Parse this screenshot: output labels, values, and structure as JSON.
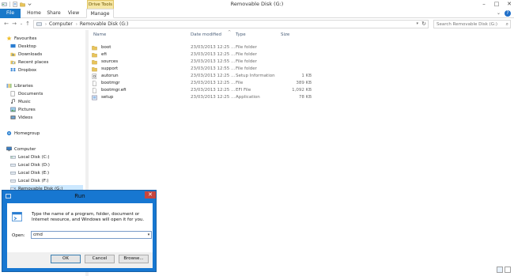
{
  "window": {
    "title": "Removable Disk (G:)",
    "contextual_tab": "Drive Tools",
    "controls": [
      "–",
      "□",
      "✕"
    ]
  },
  "ribbon": {
    "tabs": [
      {
        "label": "File",
        "active": true
      },
      {
        "label": "Home"
      },
      {
        "label": "Share"
      },
      {
        "label": "View"
      },
      {
        "label": "Manage"
      }
    ],
    "help": "?",
    "collapse": "⌄"
  },
  "address": {
    "crumbs": [
      "Computer",
      "Removable Disk (G:)"
    ],
    "separator": "›",
    "search_placeholder": "Search Removable Disk (G:)"
  },
  "nav": {
    "favourites_label": "Favourites",
    "favourites": [
      "Desktop",
      "Downloads",
      "Recent places",
      "Dropbox"
    ],
    "libraries_label": "Libraries",
    "libraries": [
      "Documents",
      "Music",
      "Pictures",
      "Videos"
    ],
    "homegroup_label": "Homegroup",
    "computer_label": "Computer",
    "computer": [
      "Local Disk (C:)",
      "Local Disk (D:)",
      "Local Disk (E:)",
      "Local Disk (F:)",
      "Removable Disk (G:)"
    ]
  },
  "columns": {
    "name": "Name",
    "date": "Date modified",
    "type": "Type",
    "size": "Size"
  },
  "files": [
    {
      "name": "boot",
      "date": "23/03/2013 12:25 ...",
      "type": "File folder",
      "size": "",
      "icon": "folder"
    },
    {
      "name": "efi",
      "date": "23/03/2013 12:25 ...",
      "type": "File folder",
      "size": "",
      "icon": "folder"
    },
    {
      "name": "sources",
      "date": "23/03/2013 12:55 ...",
      "type": "File folder",
      "size": "",
      "icon": "folder"
    },
    {
      "name": "support",
      "date": "23/03/2013 12:55 ...",
      "type": "File folder",
      "size": "",
      "icon": "folder"
    },
    {
      "name": "autorun",
      "date": "23/03/2013 12:25 ...",
      "type": "Setup Information",
      "size": "1 KB",
      "icon": "settings"
    },
    {
      "name": "bootmgr",
      "date": "23/03/2013 12:25 ...",
      "type": "File",
      "size": "389 KB",
      "icon": "file"
    },
    {
      "name": "bootmgr.efi",
      "date": "23/03/2013 12:25 ...",
      "type": "EFI File",
      "size": "1,092 KB",
      "icon": "file"
    },
    {
      "name": "setup",
      "date": "23/03/2013 12:25 ...",
      "type": "Application",
      "size": "78 KB",
      "icon": "app"
    }
  ],
  "run_dialog": {
    "title": "Run",
    "description": "Type the name of a program, folder, document or Internet resource, and Windows will open it for you.",
    "open_label": "Open:",
    "open_value": "cmd",
    "ok": "OK",
    "cancel": "Cancel",
    "browse": "Browse...",
    "close": "✕"
  },
  "colors": {
    "accent": "#1979ca",
    "dialog_frame": "#1777d1",
    "folder": "#e8c45a",
    "selection": "#cce8ff",
    "contextual_tab": "#f6e7a6"
  }
}
